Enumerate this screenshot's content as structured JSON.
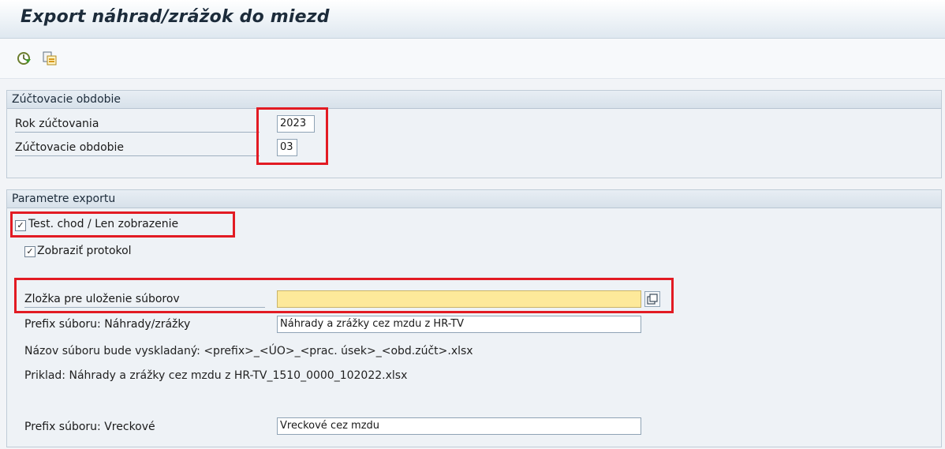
{
  "title": "Export náhrad/zrážok do miezd",
  "toolbar": {
    "execute_icon": "execute-clock-icon",
    "variant_icon": "get-variant-icon"
  },
  "period_group": {
    "header": "Zúčtovacie obdobie",
    "year_label": "Rok zúčtovania",
    "year_value": "2023",
    "period_label": "Zúčtovacie obdobie",
    "period_value": "03"
  },
  "export_group": {
    "header": "Parametre exportu",
    "test_run_label": "Test. chod / Len zobrazenie",
    "test_run_checked": true,
    "show_log_label": "Zobraziť protokol",
    "show_log_checked": true,
    "folder_label": "Zložka pre uloženie súborov",
    "folder_value": "",
    "prefix_comp_label": "Prefix súboru: Náhrady/zrážky",
    "prefix_comp_value": "Náhrady a zrážky cez mzdu z HR-TV",
    "filename_info": "Názov súboru bude vyskladaný: <prefix>_<ÚO>_<prac. úsek>_<obd.zúčt>.xlsx",
    "example_info": "Priklad: Náhrady a zrážky cez mzdu z HR-TV_1510_0000_102022.xlsx",
    "prefix_pocket_label": "Prefix súboru: Vreckové",
    "prefix_pocket_value": "Vreckové cez mzdu"
  },
  "colors": {
    "highlight": "#e21b23",
    "required_field": "#fde99a"
  }
}
